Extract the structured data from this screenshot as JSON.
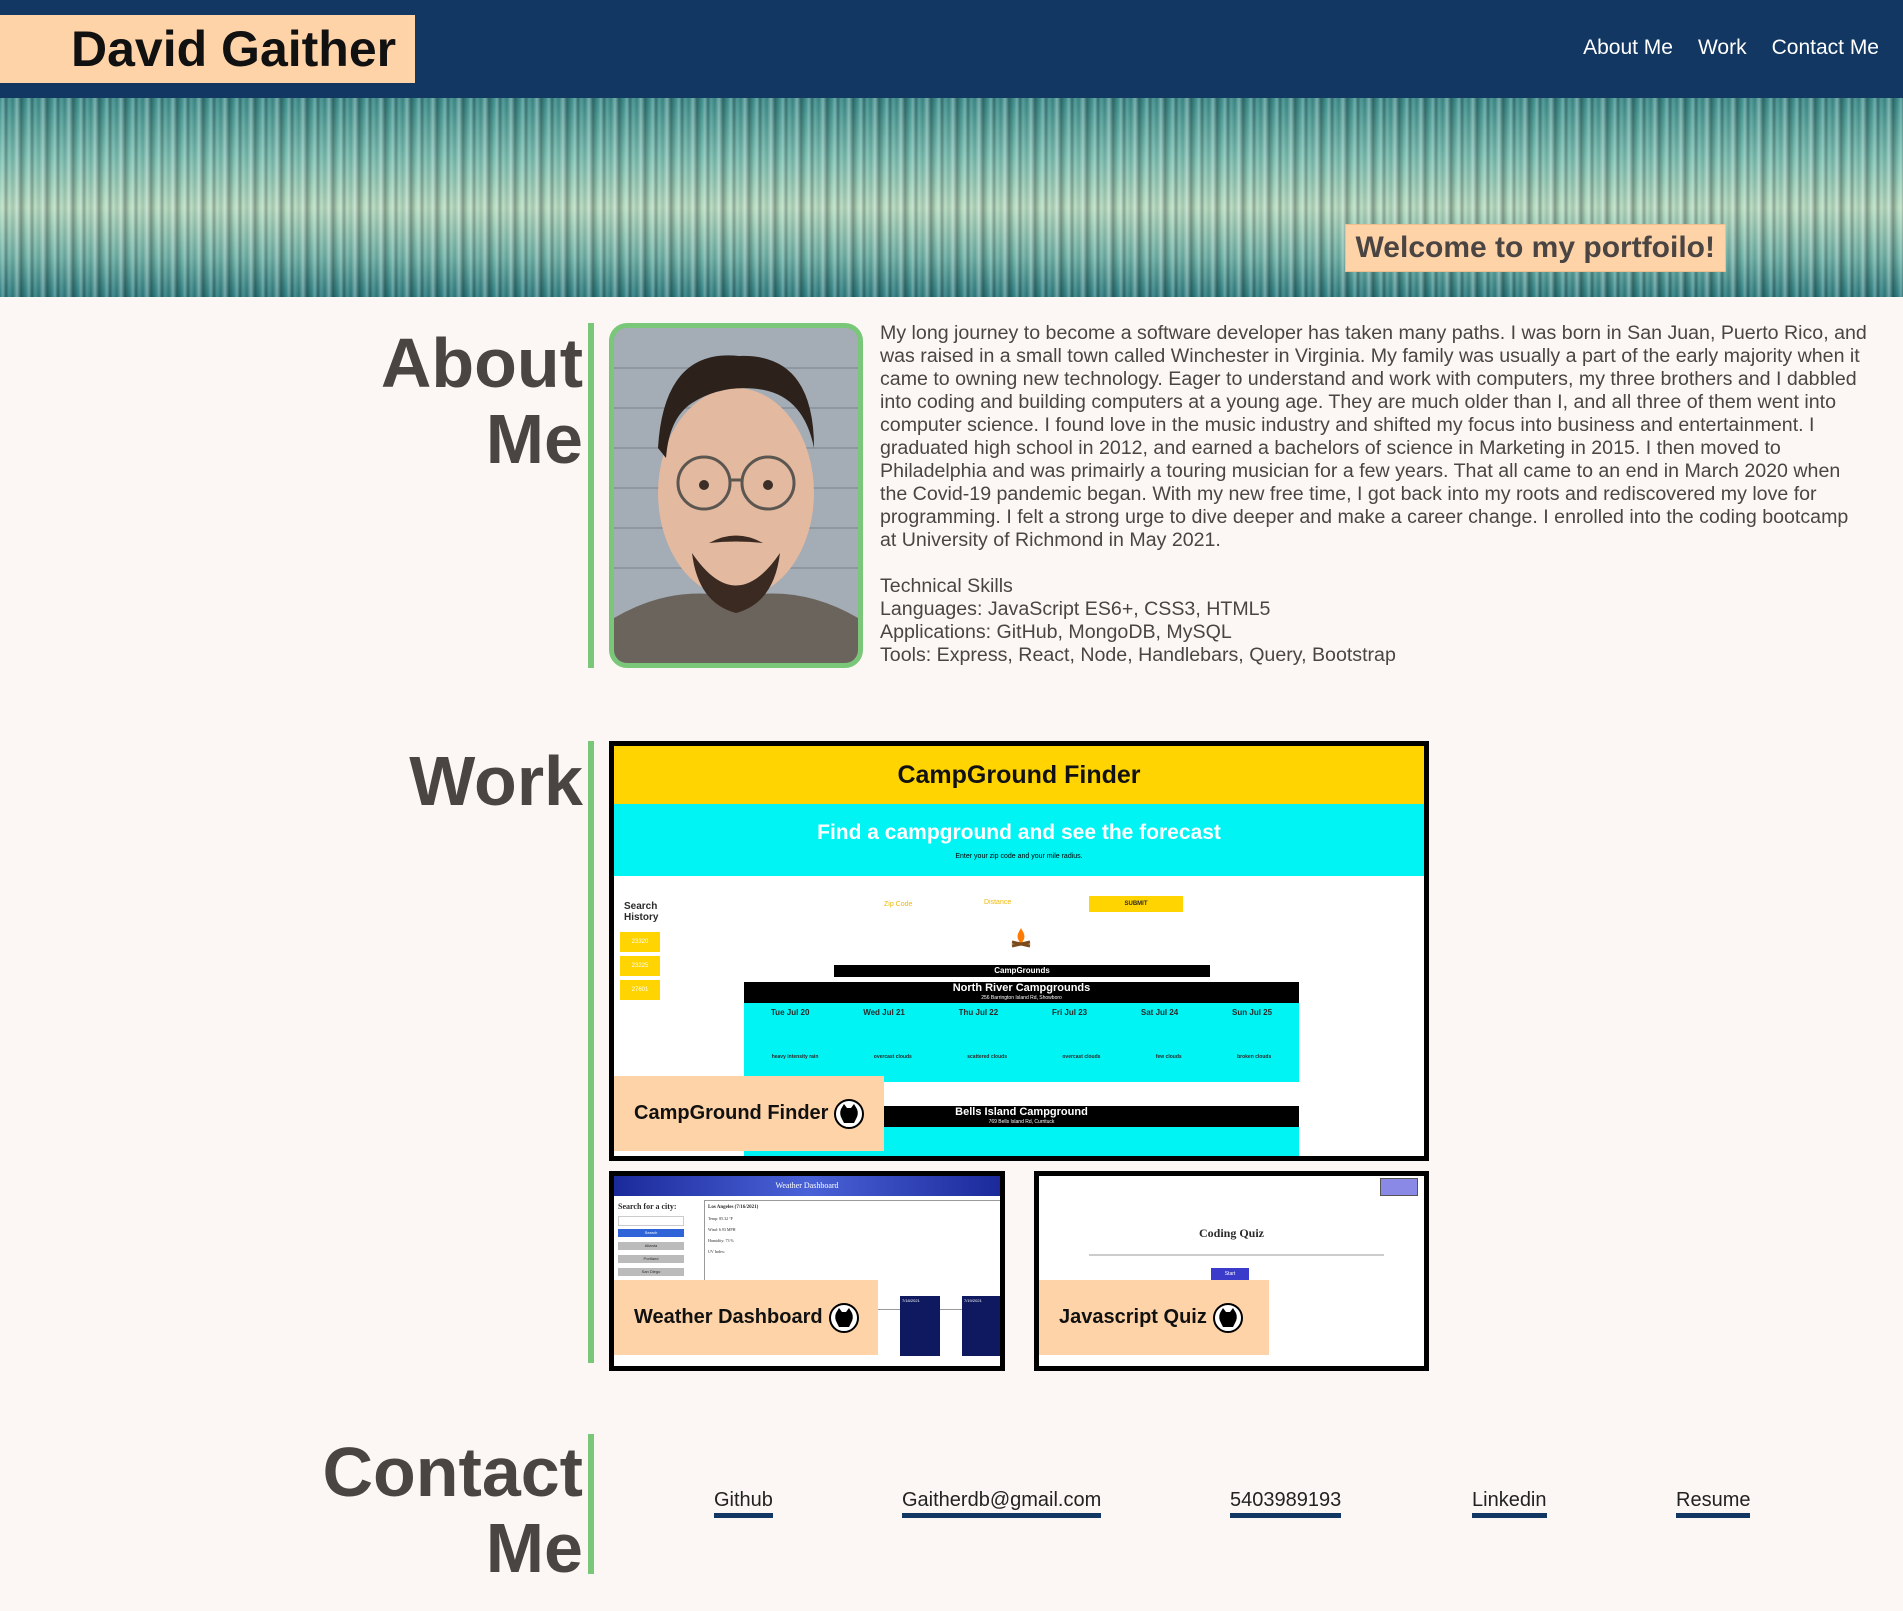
{
  "header": {
    "brand": "David Gaither",
    "nav": [
      "About Me",
      "Work",
      "Contact Me"
    ]
  },
  "hero": {
    "welcome": "Welcome to my portfoilo!"
  },
  "about": {
    "title_line1": "About",
    "title_line2": "Me",
    "bio": "My long journey to become a software developer has taken many paths. I was born in San Juan, Puerto Rico, and was raised in a small town called Winchester in Virginia. My family was usually a part of the early majority when it came to owning new technology. Eager to understand and work with computers, my three brothers and I dabbled into coding and building computers at a young age. They are much older than I, and all three of them went into computer science. I found love in the music industry and shifted my focus into business and entertainment. I graduated high school in 2012, and earned a bachelors of science in Marketing in 2015. I then moved to Philadelphia and was primairly a touring musician for a few years. That all came to an end in March 2020 when the Covid-19 pandemic began. With my new free time, I got back into my roots and rediscovered my love for programming. I felt a strong urge to dive deeper and make a career change. I enrolled into the coding bootcamp at University of Richmond in May 2021.",
    "skills_heading": "Technical Skills",
    "skills": [
      "Languages: JavaScript ES6+, CSS3, HTML5",
      "Applications: GitHub, MongoDB, MySQL",
      "Tools: Express, React, Node, Handlebars, Query, Bootstrap"
    ]
  },
  "work": {
    "title": "Work",
    "projects": [
      {
        "name": "CampGround Finder",
        "preview": {
          "header": "CampGround Finder",
          "subheader": "Find a campground and see the forecast",
          "hint": "Enter your zip code and your mile radius.",
          "search_history": "Search History",
          "history": [
            "23320",
            "23225",
            "27601"
          ],
          "zip_label": "Zip Code",
          "distance_label": "Distance",
          "submit": "SUBMIT",
          "campgrounds": "CampGrounds",
          "sites": [
            {
              "name": "North River Campgrounds",
              "address": "256 Barrington Island Rd, Showboro"
            },
            {
              "name": "Bells Island Campground",
              "address": "769 Bells Island Rd, Currituck"
            }
          ],
          "days": [
            "Tue Jul 20",
            "Wed Jul 21",
            "Thu Jul 22",
            "Fri Jul 23",
            "Sat Jul 24",
            "Sun Jul 25"
          ],
          "conditions": [
            "heavy intensity rain",
            "overcast clouds",
            "scattered clouds",
            "overcast clouds",
            "few clouds",
            "broken clouds"
          ]
        }
      },
      {
        "name": "Weather Dashboard",
        "preview": {
          "header": "Weather Dashboard",
          "search": "Search for a city:",
          "city": "Los Angeles (7/16/2021)",
          "buttons": [
            "Search",
            "Atlanta",
            "Portland",
            "San Diego"
          ],
          "stats": [
            "Temp: 85.32 °F",
            "Wind: 6.93 MPH",
            "Humidity: 73 %",
            "UV Index:"
          ],
          "forecast": [
            "7/18/2021",
            "7/19/2021"
          ]
        }
      },
      {
        "name": "Javascript Quiz",
        "preview": {
          "title": "Coding Quiz",
          "start": "Start"
        }
      }
    ]
  },
  "contact": {
    "title_line1": "Contact",
    "title_line2": "Me",
    "links": [
      "Github",
      "Gaitherdb@gmail.com",
      "5403989193",
      "Linkedin",
      "Resume"
    ]
  },
  "colors": {
    "header_bg": "#123762",
    "accent_peach": "#ffd3a8",
    "accent_green": "#7ac77a",
    "page_bg": "#fcf7f4"
  }
}
